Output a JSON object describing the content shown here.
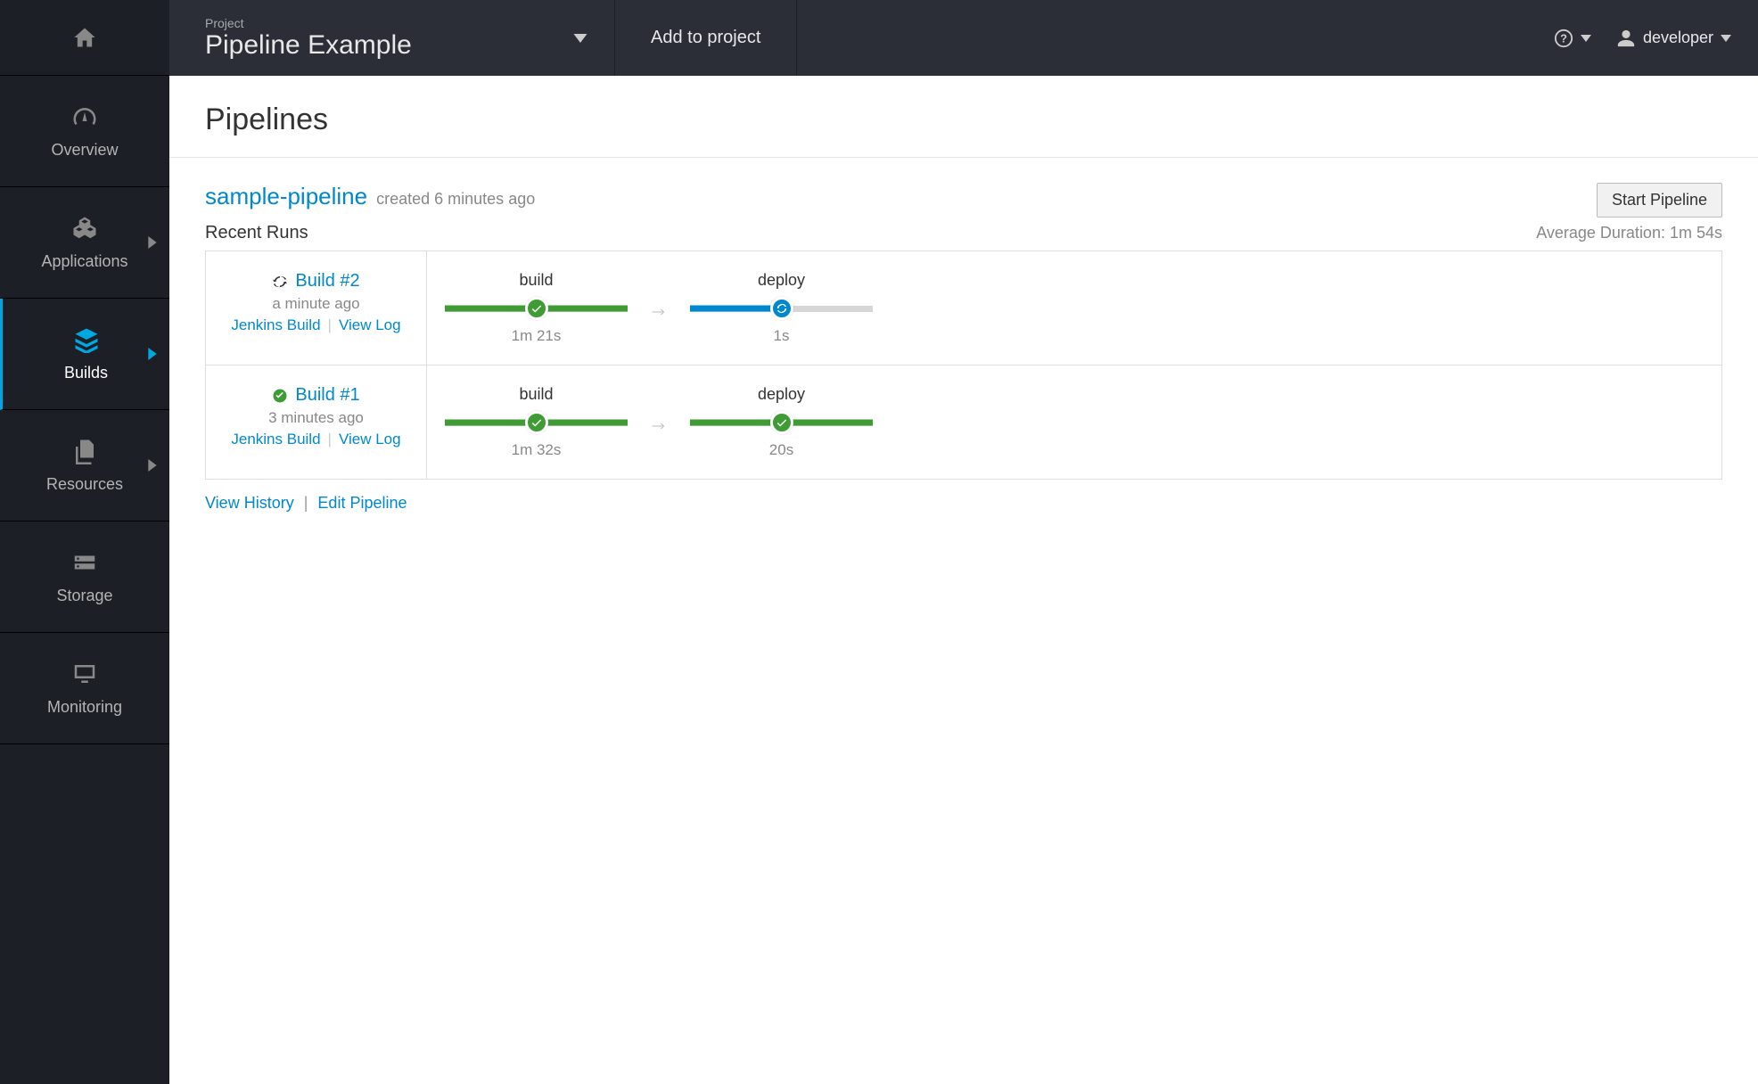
{
  "topbar": {
    "project_label": "Project",
    "project_name": "Pipeline Example",
    "add_to_project": "Add to project",
    "username": "developer"
  },
  "sidebar": {
    "items": [
      {
        "label": "Overview"
      },
      {
        "label": "Applications"
      },
      {
        "label": "Builds"
      },
      {
        "label": "Resources"
      },
      {
        "label": "Storage"
      },
      {
        "label": "Monitoring"
      }
    ]
  },
  "page": {
    "title": "Pipelines"
  },
  "pipeline": {
    "name": "sample-pipeline",
    "created": "created 6 minutes ago",
    "start_button": "Start Pipeline",
    "recent_runs_label": "Recent Runs",
    "avg_duration": "Average Duration: 1m 54s",
    "view_history": "View History",
    "edit_pipeline": "Edit Pipeline"
  },
  "runs": [
    {
      "status": "running",
      "name": "Build #2",
      "time": "a minute ago",
      "jenkins": "Jenkins Build",
      "viewlog": "View Log",
      "stages": [
        {
          "label": "build",
          "duration": "1m 21s",
          "state": "complete",
          "fill_pct": 100,
          "color": "green"
        },
        {
          "label": "deploy",
          "duration": "1s",
          "state": "running",
          "fill_pct": 50,
          "color": "blue"
        }
      ]
    },
    {
      "status": "complete",
      "name": "Build #1",
      "time": "3 minutes ago",
      "jenkins": "Jenkins Build",
      "viewlog": "View Log",
      "stages": [
        {
          "label": "build",
          "duration": "1m 32s",
          "state": "complete",
          "fill_pct": 100,
          "color": "green"
        },
        {
          "label": "deploy",
          "duration": "20s",
          "state": "complete",
          "fill_pct": 100,
          "color": "green"
        }
      ]
    }
  ]
}
